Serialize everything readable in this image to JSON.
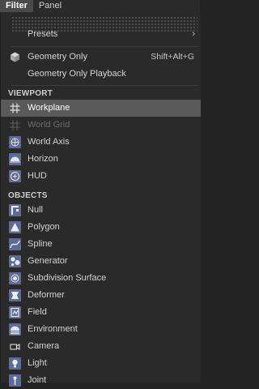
{
  "menubar": {
    "filter": "Filter",
    "panel": "Panel"
  },
  "menu": {
    "presets": "Presets",
    "geometry_only": "Geometry Only",
    "geometry_only_shortcut": "Shift+Alt+G",
    "geometry_only_playback": "Geometry Only Playback",
    "viewport_header": "VIEWPORT",
    "viewport": [
      {
        "label": "Workplane",
        "icon": "workplane-icon",
        "selected": true
      },
      {
        "label": "World Grid",
        "icon": "world-grid-icon",
        "disabled": true
      },
      {
        "label": "World Axis",
        "icon": "world-axis-icon"
      },
      {
        "label": "Horizon",
        "icon": "horizon-icon"
      },
      {
        "label": "HUD",
        "icon": "hud-icon"
      }
    ],
    "objects_header": "OBJECTS",
    "objects": [
      {
        "label": "Null",
        "icon": "null-icon"
      },
      {
        "label": "Polygon",
        "icon": "polygon-icon"
      },
      {
        "label": "Spline",
        "icon": "spline-icon"
      },
      {
        "label": "Generator",
        "icon": "generator-icon"
      },
      {
        "label": "Subdivision Surface",
        "icon": "subdivision-surface-icon"
      },
      {
        "label": "Deformer",
        "icon": "deformer-icon"
      },
      {
        "label": "Field",
        "icon": "field-icon"
      },
      {
        "label": "Environment",
        "icon": "environment-icon"
      },
      {
        "label": "Camera",
        "icon": "camera-icon"
      },
      {
        "label": "Light",
        "icon": "light-icon"
      },
      {
        "label": "Joint",
        "icon": "joint-icon"
      }
    ]
  },
  "colors": {
    "selected_bg": "#5a5a5a",
    "icon_bg": "#5d6a9a",
    "menu_bg": "#2a2a2a"
  }
}
